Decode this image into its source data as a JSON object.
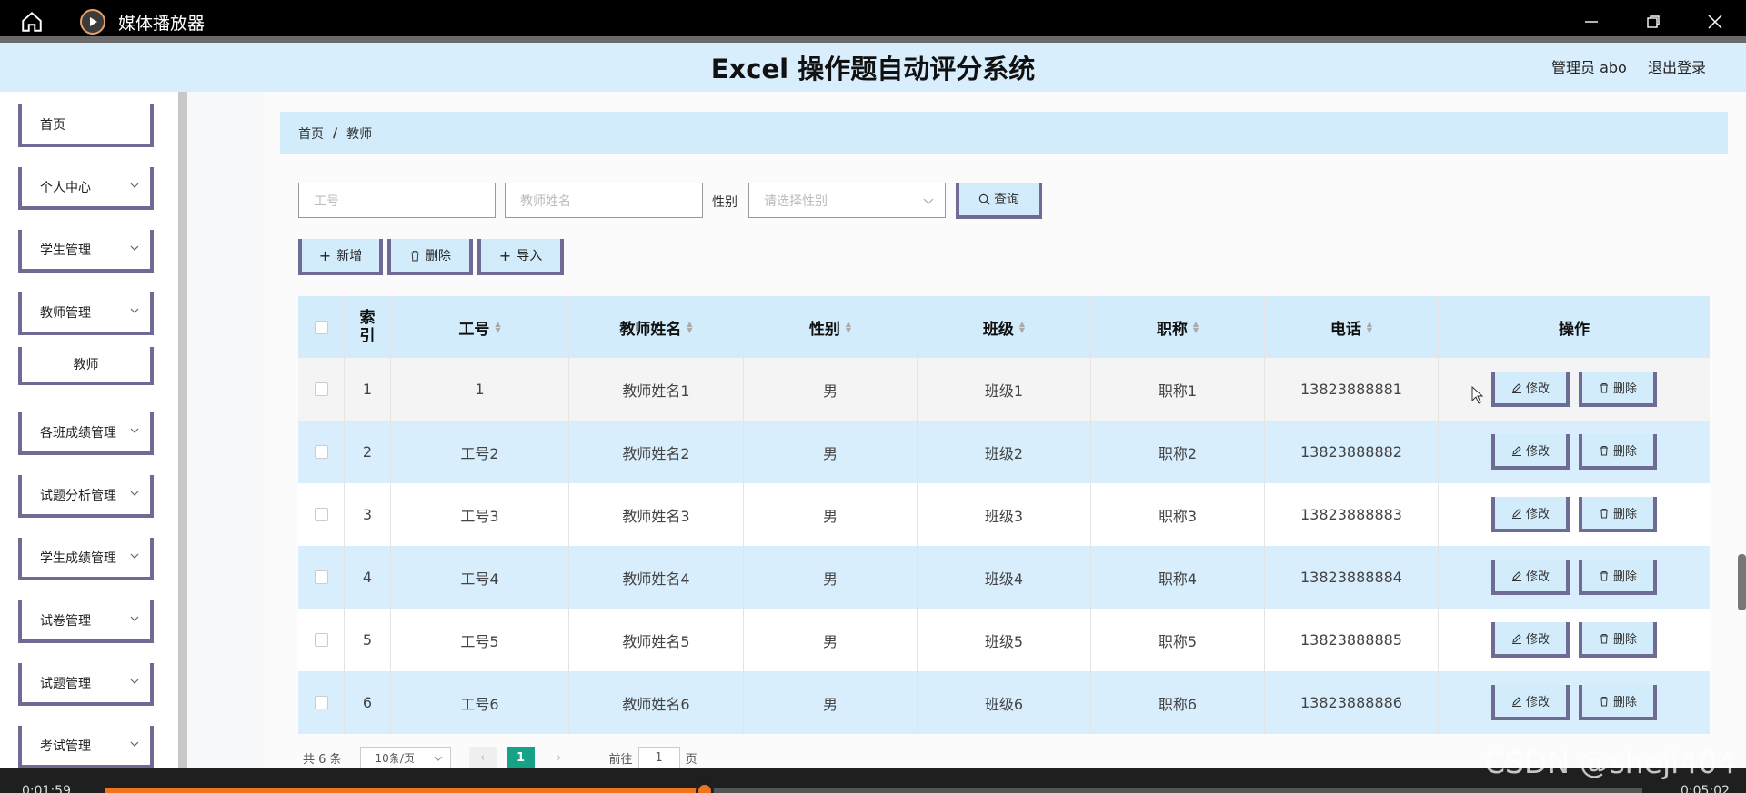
{
  "player": {
    "title": "媒体播放器",
    "time_elapsed": "0:01:59",
    "time_total": "0:05:02",
    "progress": 0.39
  },
  "header": {
    "title": "Excel 操作题自动评分系统",
    "user": "管理员 abo",
    "logout": "退出登录"
  },
  "sidebar": {
    "items": [
      {
        "label": "首页"
      },
      {
        "label": "个人中心"
      },
      {
        "label": "学生管理"
      },
      {
        "label": "教师管理"
      },
      {
        "label": "教师"
      },
      {
        "label": "各班成绩管理"
      },
      {
        "label": "试题分析管理"
      },
      {
        "label": "学生成绩管理"
      },
      {
        "label": "试卷管理"
      },
      {
        "label": "试题管理"
      },
      {
        "label": "考试管理"
      }
    ]
  },
  "breadcrumb": {
    "home": "首页",
    "sep": "/",
    "current": "教师"
  },
  "search": {
    "no_placeholder": "工号",
    "name_placeholder": "教师姓名",
    "sex_label": "性别",
    "sex_placeholder": "请选择性别",
    "query": "查询"
  },
  "actions": {
    "add": "新增",
    "delete": "删除",
    "import": "导入"
  },
  "table": {
    "headers": {
      "idx": "索引",
      "no": "工号",
      "name": "教师姓名",
      "sex": "性别",
      "cls": "班级",
      "title": "职称",
      "phone": "电话",
      "op": "操作"
    },
    "edit": "修改",
    "del": "删除",
    "rows": [
      {
        "idx": "1",
        "no": "1",
        "name": "教师姓名1",
        "sex": "男",
        "cls": "班级1",
        "title": "职称1",
        "phone": "13823888881"
      },
      {
        "idx": "2",
        "no": "工号2",
        "name": "教师姓名2",
        "sex": "男",
        "cls": "班级2",
        "title": "职称2",
        "phone": "13823888882"
      },
      {
        "idx": "3",
        "no": "工号3",
        "name": "教师姓名3",
        "sex": "男",
        "cls": "班级3",
        "title": "职称3",
        "phone": "13823888883"
      },
      {
        "idx": "4",
        "no": "工号4",
        "name": "教师姓名4",
        "sex": "男",
        "cls": "班级4",
        "title": "职称4",
        "phone": "13823888884"
      },
      {
        "idx": "5",
        "no": "工号5",
        "name": "教师姓名5",
        "sex": "男",
        "cls": "班级5",
        "title": "职称5",
        "phone": "13823888885"
      },
      {
        "idx": "6",
        "no": "工号6",
        "name": "教师姓名6",
        "sex": "男",
        "cls": "班级6",
        "title": "职称6",
        "phone": "13823888886"
      }
    ]
  },
  "pager": {
    "total": "共 6 条",
    "size": "10条/页",
    "current": "1",
    "goto": "前往",
    "goto_value": "1",
    "page_unit": "页"
  },
  "watermark": "CSDN @sheji404"
}
